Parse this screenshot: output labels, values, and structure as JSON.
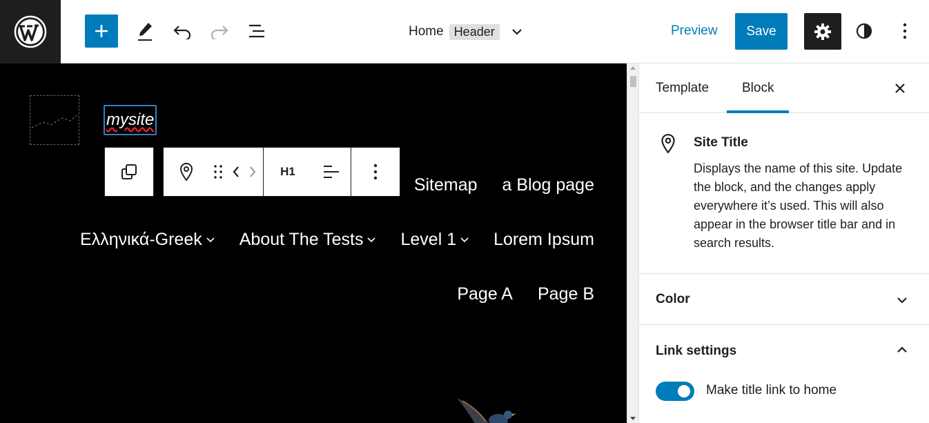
{
  "topbar": {
    "document_title": "Home",
    "document_tag": "Header",
    "preview_label": "Preview",
    "save_label": "Save"
  },
  "canvas": {
    "site_title": "mysite",
    "nav_rows": [
      {
        "items": [
          {
            "label": "Sitemap",
            "has_submenu": false
          },
          {
            "label": "a Blog page",
            "has_submenu": false
          }
        ]
      },
      {
        "items": [
          {
            "label": "Ελληνικά-Greek",
            "has_submenu": true
          },
          {
            "label": "About The Tests",
            "has_submenu": true
          },
          {
            "label": "Level 1",
            "has_submenu": true
          },
          {
            "label": "Lorem Ipsum",
            "has_submenu": false
          }
        ]
      },
      {
        "items": [
          {
            "label": "Page A",
            "has_submenu": false
          },
          {
            "label": "Page B",
            "has_submenu": false
          }
        ]
      }
    ],
    "block_toolbar": {
      "heading_level": "H1"
    }
  },
  "sidebar": {
    "tabs": [
      {
        "label": "Template"
      },
      {
        "label": "Block"
      }
    ],
    "active_tab": "Block",
    "block_card": {
      "title": "Site Title",
      "description": "Displays the name of this site. Update the block, and the changes apply everywhere it’s used. This will also appear in the browser title bar and in search results."
    },
    "panels": [
      {
        "title": "Color",
        "expanded": false
      },
      {
        "title": "Link settings",
        "expanded": true
      }
    ],
    "link_settings": {
      "toggle_label": "Make title link to home",
      "toggle_on": true
    }
  },
  "colors": {
    "accent": "#007cba",
    "dark": "#1e1e1e",
    "canvas_bg": "#000000"
  }
}
